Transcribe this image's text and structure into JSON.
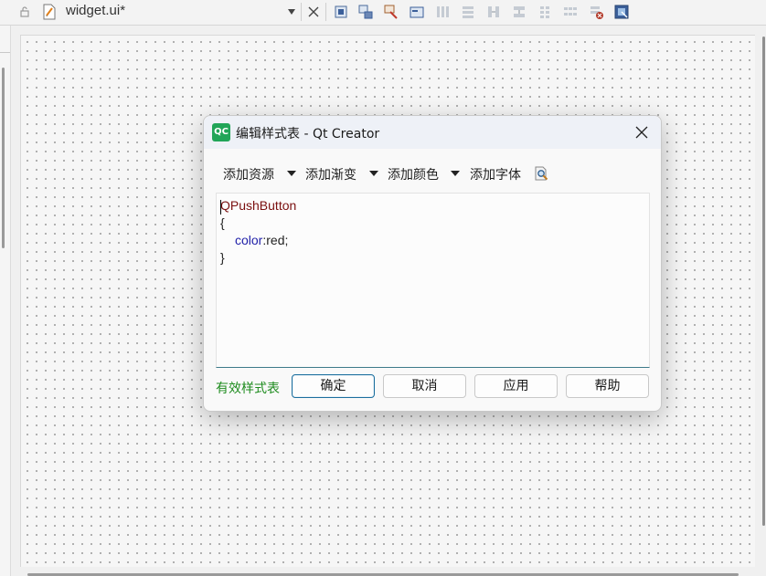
{
  "editor_tab": {
    "file_name": "widget.ui*"
  },
  "toolbar_icons": [
    "edit-widgets-icon",
    "edit-signals-slots-icon",
    "edit-buddies-icon",
    "edit-tab-order-icon",
    "layout-horizontal-icon",
    "layout-vertical-icon",
    "layout-horizontal-splitter-icon",
    "layout-vertical-splitter-icon",
    "layout-form-icon",
    "layout-grid-icon",
    "break-layout-icon",
    "adjust-size-icon"
  ],
  "dialog": {
    "app_icon_text": "QC",
    "title": "编辑样式表 - Qt Creator",
    "actions": {
      "add_resource": "添加资源",
      "add_gradient": "添加渐变",
      "add_color": "添加颜色",
      "add_font": "添加字体"
    },
    "code": {
      "line1": "QPushButton",
      "line2": "{",
      "line3_property": "color",
      "line3_rest": ":red;",
      "line4": "}"
    },
    "valid_label": "有效样式表",
    "buttons": {
      "ok": "确定",
      "cancel": "取消",
      "apply": "应用",
      "help": "帮助"
    }
  },
  "colors": {
    "valid_text": "#1e8c1e",
    "selector": "#7a0f0f",
    "property": "#1f1fa8",
    "qt_green": "#21a558"
  }
}
